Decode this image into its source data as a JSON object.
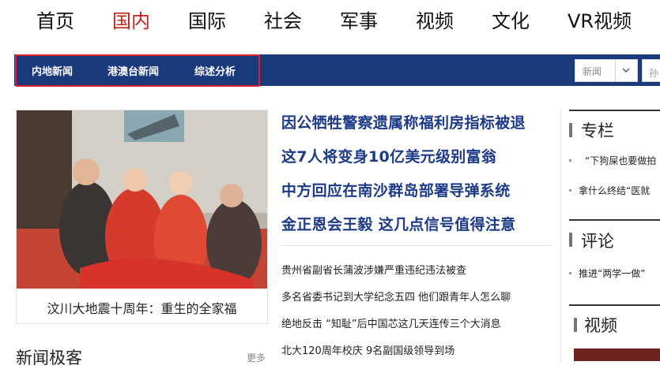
{
  "top_nav": {
    "items": [
      {
        "label": "首页"
      },
      {
        "label": "国内"
      },
      {
        "label": "国际"
      },
      {
        "label": "社会"
      },
      {
        "label": "军事"
      },
      {
        "label": "视频"
      },
      {
        "label": "文化"
      },
      {
        "label": "VR视频"
      }
    ],
    "active_color": "#c0221f"
  },
  "sub_nav": {
    "items": [
      {
        "label": "内地新闻"
      },
      {
        "label": "港澳台新闻"
      },
      {
        "label": "综述分析"
      }
    ],
    "bar_color": "#1b3a7b",
    "highlight_color": "#e0212c"
  },
  "search": {
    "category_value": "新闻",
    "input_text": "孙"
  },
  "photo": {
    "caption": "汶川大地震十周年：重生的全家福"
  },
  "headlines": [
    "因公牺牲警察遗属称福利房指标被退",
    "这7人将变身10亿美元级别富翁",
    "中方回应在南沙群岛部署导弹系统",
    "金正恩会王毅 这几点信号值得注意"
  ],
  "news_list": [
    "贵州省副省长蒲波涉嫌严重违纪违法被查",
    "多名省委书记到大学纪念五四 他们跟青年人怎么聊",
    "绝地反击 “知耻”后中国芯这几天连传三个大消息",
    "北大120周年校庆 9名副国级领导到场"
  ],
  "left_section": {
    "title": "新闻极客",
    "more": "更多"
  },
  "sidebar": {
    "column": {
      "title": "专栏",
      "items": [
        "“下狗屎也要做拍",
        "拿什么终结“医就"
      ]
    },
    "comment": {
      "title": "评论",
      "items": [
        "推进“两学一做”"
      ]
    },
    "video": {
      "title": "视频"
    }
  },
  "colors": {
    "headline": "#1d3a86",
    "text": "#222222"
  }
}
